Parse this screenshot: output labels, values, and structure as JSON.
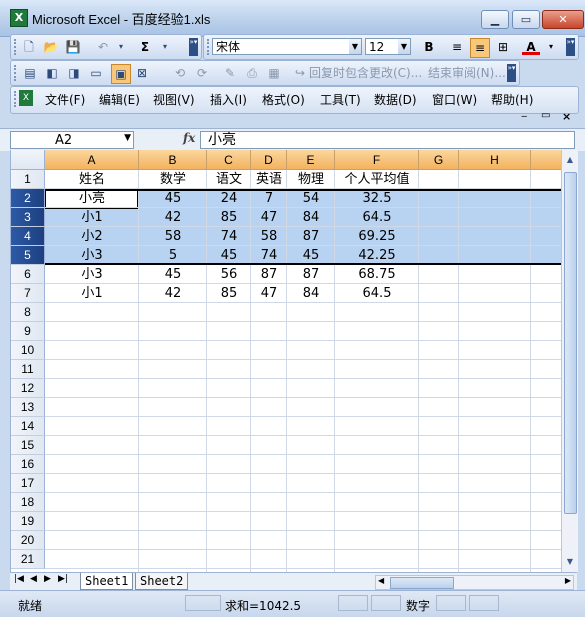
{
  "window": {
    "title": "Microsoft Excel - 百度经验1.xls",
    "app_icon": "X"
  },
  "toolbar": {
    "sum_symbol": "Σ",
    "font_name": "宋体",
    "font_size": "12",
    "bold": "B",
    "font_color_letter": "A",
    "reply_changes": "回复时包含更改(C)...",
    "end_review": "结束审阅(N)..."
  },
  "menu": [
    "文件(F)",
    "编辑(E)",
    "视图(V)",
    "插入(I)",
    "格式(O)",
    "工具(T)",
    "数据(D)",
    "窗口(W)",
    "帮助(H)"
  ],
  "formula_bar": {
    "name_box": "A2",
    "fx": "fx",
    "value": "小亮"
  },
  "columns": [
    "A",
    "B",
    "C",
    "D",
    "E",
    "F",
    "G",
    "H"
  ],
  "rows": [
    "1",
    "2",
    "3",
    "4",
    "5",
    "6",
    "7",
    "8",
    "9",
    "10",
    "11",
    "12",
    "13",
    "14",
    "15",
    "16",
    "17",
    "18",
    "19",
    "20",
    "21"
  ],
  "table": {
    "headers": [
      "姓名",
      "数学",
      "语文",
      "英语",
      "物理",
      "个人平均值"
    ],
    "data": [
      [
        "小亮",
        "45",
        "24",
        "7",
        "54",
        "32.5"
      ],
      [
        "小1",
        "42",
        "85",
        "47",
        "84",
        "64.5"
      ],
      [
        "小2",
        "58",
        "74",
        "58",
        "87",
        "69.25"
      ],
      [
        "小3",
        "5",
        "45",
        "74",
        "45",
        "42.25"
      ],
      [
        "小3",
        "45",
        "56",
        "87",
        "87",
        "68.75"
      ],
      [
        "小1",
        "42",
        "85",
        "47",
        "84",
        "64.5"
      ]
    ]
  },
  "sheets": [
    "Sheet1",
    "Sheet2"
  ],
  "status": {
    "ready": "就绪",
    "sum": "求和=1042.5",
    "mode": "数字"
  },
  "colors": {
    "selection": "#b8d2f1",
    "header_orange": "#f3b25e",
    "selected_row_header": "#1d3f80"
  }
}
